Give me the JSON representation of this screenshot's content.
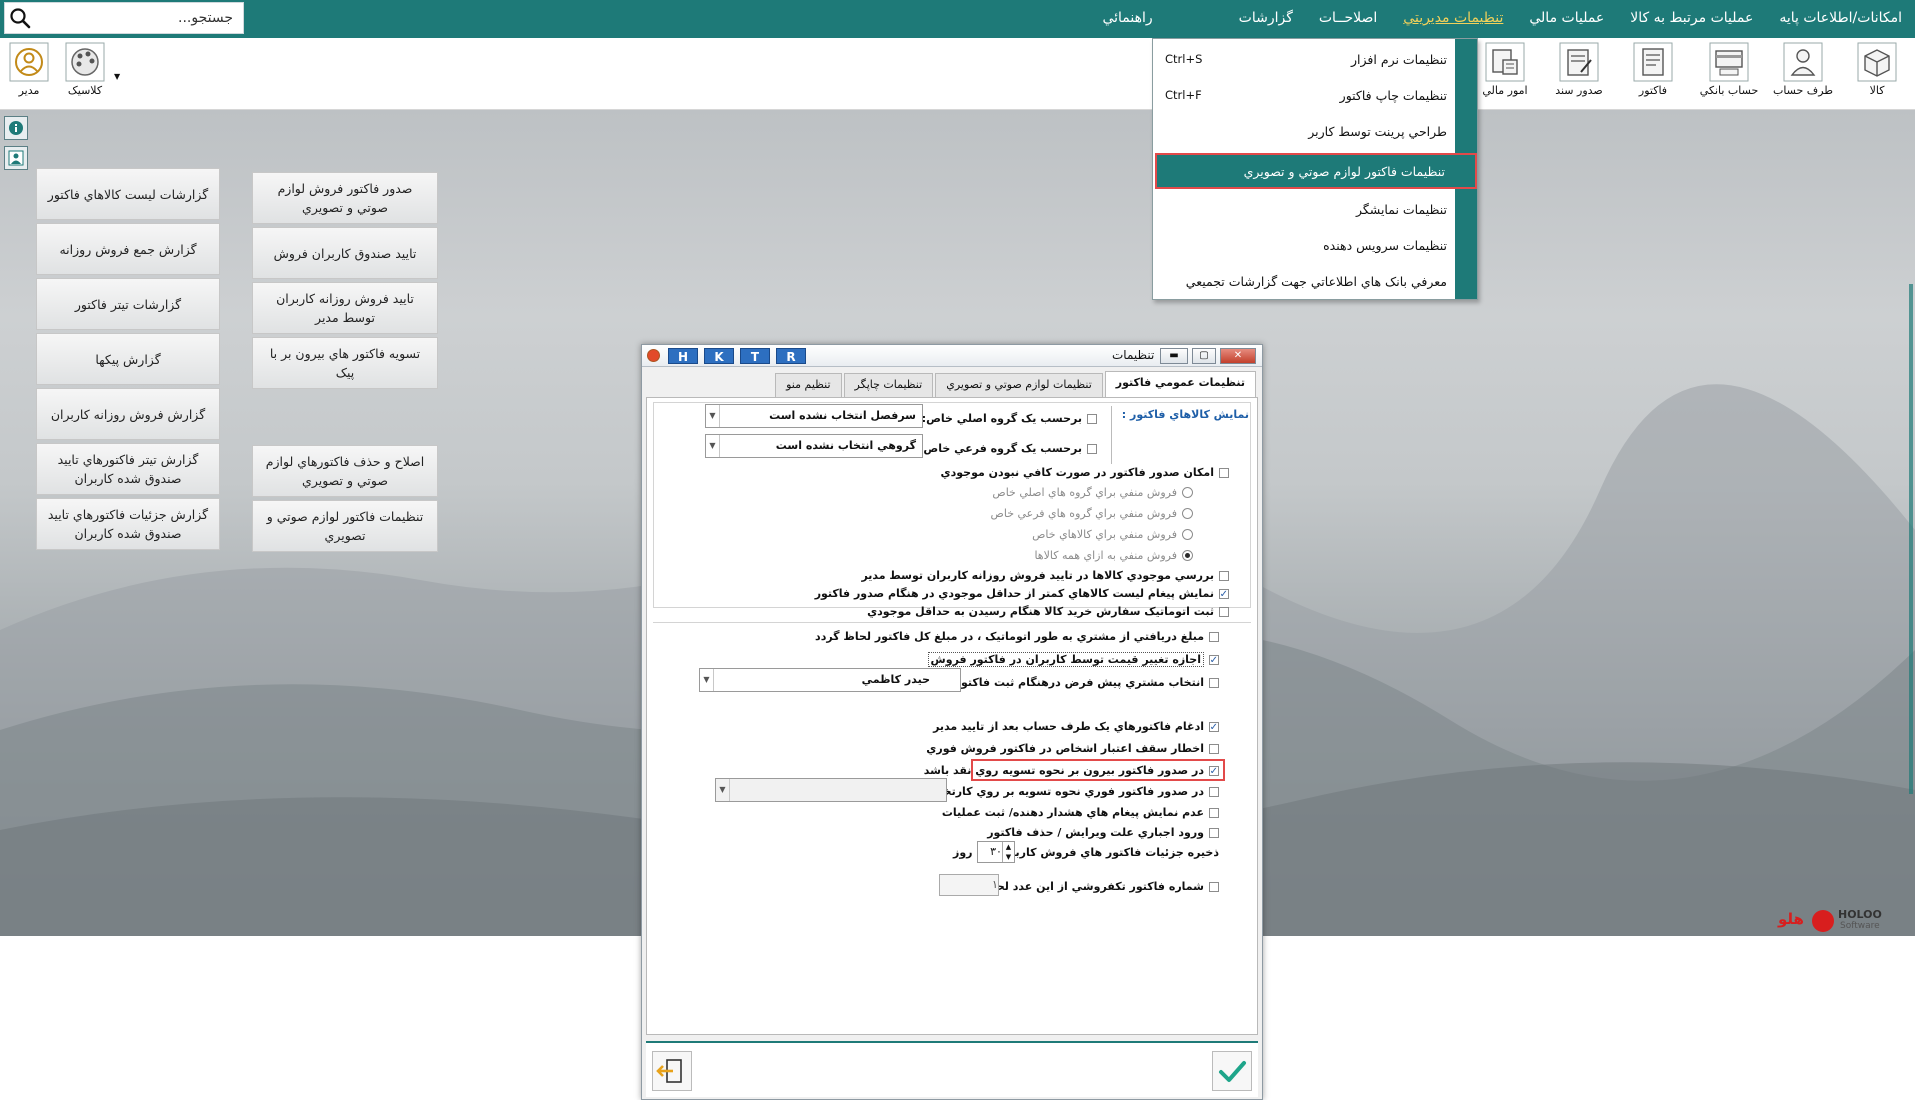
{
  "menubar": {
    "search_placeholder": "جستجو...",
    "menus": [
      {
        "label": "امکانات/اطلاعات پايه"
      },
      {
        "label": "عمليات مرتبط به کالا"
      },
      {
        "label": "عمليات مالي"
      },
      {
        "label": "تنظيمات مديريتي"
      },
      {
        "label": "اصلاحــات"
      },
      {
        "label": "گزارشات"
      },
      {
        "label": "راهنمائي"
      }
    ],
    "active_menu": "تنظيمات مديريتي"
  },
  "toolbar": {
    "left_items": [
      {
        "label": "مدير",
        "icon": "user-circle-icon"
      },
      {
        "label": "کلاسيک",
        "icon": "palette-icon"
      }
    ],
    "right_items": [
      {
        "label": "کالا",
        "icon": "box-icon"
      },
      {
        "label": "طرف حساب",
        "icon": "person-icon"
      },
      {
        "label": "حساب بانکي",
        "icon": "bank-card-icon"
      },
      {
        "label": "فاکتور",
        "icon": "invoice-icon"
      },
      {
        "label": "صدور سند",
        "icon": "document-pen-icon"
      },
      {
        "label": "امور مالي",
        "icon": "finance-icon"
      }
    ]
  },
  "reports": {
    "left_column": [
      "گزارشات ليست کالاهاي فاکتور",
      "گزارش جمع فروش روزانه",
      "گزارشات تيتر فاکتور",
      "گزارش پيکها",
      "گزارش فروش روزانه کاربران",
      "گزارش تيتر فاکتورهاي تاييد صندوق شده کاربران",
      "گزارش جزئيات فاکتورهاي تاييد صندوق شده کاربران"
    ],
    "right_column": [
      "صدور فاکتور فروش لوازم صوتي و تصويري",
      "تاييد صندوق کاربران فروش",
      "تاييد فروش روزانه کاربران توسط مدير",
      "تسويه فاکتور هاي بيرون بر با پيک",
      "اصلاح و حذف فاکتورهاي لوازم صوتي و تصويري",
      "تنظيمات فاکتور لوازم صوتي و تصويري"
    ]
  },
  "dropdown": {
    "items": [
      {
        "label": "تنظيمات نرم افزار",
        "shortcut": "Ctrl+S"
      },
      {
        "label": "تنظيمات چاپ فاکتور",
        "shortcut": "Ctrl+F"
      },
      {
        "label": "طراحي پرينت توسط کاربر",
        "shortcut": ""
      },
      {
        "label": "تنظيمات فاکتور لوازم صوتي و تصويري",
        "shortcut": ""
      },
      {
        "label": "تنظيمات نمايشگر",
        "shortcut": ""
      },
      {
        "label": "تنظيمات سرويس دهنده",
        "shortcut": ""
      },
      {
        "label": "معرفي بانک هاي اطلاعاتي جهت گزارشات تجميعي",
        "shortcut": ""
      }
    ],
    "selected_index": 3
  },
  "dialog": {
    "title": "تنظيمات",
    "hotkeys": [
      "H",
      "K",
      "T",
      "R"
    ],
    "tabs": [
      "تنظيمات عمومي فاکتور",
      "تنظيمات لوازم صوتي و تصويري",
      "تنظيمات چاپگر",
      "تنظيم منو"
    ],
    "active_tab": "تنظيمات عمومي فاکتور",
    "section_label": "نمايش کالاهاي فاکتور :",
    "group_main_label": "برحسب يک گروه اصلي خاص:",
    "group_main_value": "سرفصل انتخاب نشده است",
    "group_sub_label": "برحسب يک گروه فرعي خاص:",
    "group_sub_value": "گروهي انتخاب نشده است",
    "allow_negative": "امکان صدور فاکتور در صورت کافي نبودن موجودي",
    "radios": [
      {
        "label": "فروش منفي براي گروه هاي اصلي خاص",
        "checked": false
      },
      {
        "label": "فروش منفي براي گروه هاي فرعي خاص",
        "checked": false
      },
      {
        "label": "فروش منفي براي کالاهاي خاص",
        "checked": false
      },
      {
        "label": "فروش منفي به ازاي همه کالاها",
        "checked": true
      }
    ],
    "options_a": [
      {
        "label": "بررسي موجودي کالاها در تاييد فروش روزانه کاربران توسط مدير",
        "checked": false
      },
      {
        "label": "نمايش پيغام ليست کالاهاي کمتر از حداقل موجودي در هنگام صدور فاکتور",
        "checked": true
      },
      {
        "label": "ثبت اتوماتيک سفارش خريد کالا هنگام رسيدن به حداقل موجودي",
        "checked": false
      }
    ],
    "auto_payment": "مبلغ دريافتي از مشتري به طور اتوماتيک ، در مبلغ کل فاکتور لحاظ  گردد",
    "allow_price_change": "اجازه تغيير قيمت توسط کاربران در فاکتور فروش",
    "default_customer_label": "انتخاب مشتري پيش فرض درهنگام ثبت فاکتور:",
    "default_customer_value": "حيدر کاظمي",
    "options_b": [
      {
        "label": "ادغام فاکتورهاي يک طرف حساب بعد از تاييد مدير",
        "checked": true
      },
      {
        "label": "اخطار سقف اعتبار اشخاص در فاکتور فروش فوري",
        "checked": false
      },
      {
        "label": "در صدور فاکتور بيرون بر نحوه تسويه روي نقد باشد",
        "checked": true
      },
      {
        "label": "در صدور فاکتور فوري نحوه تسويه بر روي کارتخوان باشد",
        "checked": false
      },
      {
        "label": "عدم نمايش پيغام هاي هشدار دهنده/ ثبت عمليات",
        "checked": false
      },
      {
        "label": "ورود اجباري علت ويرايش / حذف فاکتور",
        "checked": false
      }
    ],
    "save_days_label": "ذخيره  جزئيات فاکتور هاي فروش کاربران تا",
    "save_days_value": "۳۰",
    "save_days_unit": "روز",
    "phone_number_label": "شماره فاکتور تکفروشي از اين عدد لحاظ شود",
    "phone_number_value": "۱"
  },
  "brand": {
    "latin": "HOLOO",
    "latin_sub": "Software",
    "persian": "هلو"
  },
  "colors": {
    "bar": "#1e7a78",
    "active_menu": "#f2d15a",
    "highlight": "#e24a4a",
    "hotkey": "#2d6fc0"
  }
}
